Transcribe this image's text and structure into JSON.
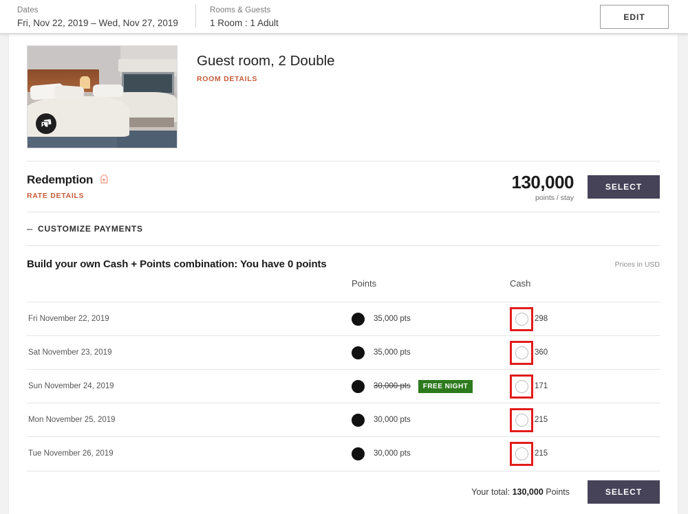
{
  "topbar": {
    "dates_label": "Dates",
    "dates_value": "Fri, Nov 22, 2019 – Wed, Nov 27, 2019",
    "guests_label": "Rooms & Guests",
    "guests_value": "1 Room : 1 Adult",
    "edit_button": "EDIT"
  },
  "room": {
    "title": "Guest room, 2 Double",
    "details_link": "ROOM DETAILS",
    "photo_badge_icon": "photo-gallery-icon"
  },
  "rate": {
    "name": "Redemption",
    "tag_icon": "tag-icon",
    "details_link": "RATE DETAILS",
    "price_amount": "130,000",
    "price_unit": "points / stay",
    "select_button": "SELECT"
  },
  "customize": {
    "toggle_glyph": "–",
    "label": "CUSTOMIZE PAYMENTS"
  },
  "build": {
    "title": "Build your own Cash + Points combination: You have 0 points",
    "prices_note": "Prices in USD",
    "col_points": "Points",
    "col_cash": "Cash",
    "rows": [
      {
        "date": "Fri November 22, 2019",
        "points": "35,000 pts",
        "points_selected": true,
        "points_struck": false,
        "badge": null,
        "cash": "298",
        "cash_selected": false,
        "cash_highlight": true
      },
      {
        "date": "Sat November 23, 2019",
        "points": "35,000 pts",
        "points_selected": true,
        "points_struck": false,
        "badge": null,
        "cash": "360",
        "cash_selected": false,
        "cash_highlight": true
      },
      {
        "date": "Sun November 24, 2019",
        "points": "30,000 pts",
        "points_selected": true,
        "points_struck": true,
        "badge": "FREE NIGHT",
        "cash": "171",
        "cash_selected": false,
        "cash_highlight": true
      },
      {
        "date": "Mon November 25, 2019",
        "points": "30,000 pts",
        "points_selected": true,
        "points_struck": false,
        "badge": null,
        "cash": "215",
        "cash_selected": false,
        "cash_highlight": true
      },
      {
        "date": "Tue November 26, 2019",
        "points": "30,000 pts",
        "points_selected": true,
        "points_struck": false,
        "badge": null,
        "cash": "215",
        "cash_selected": false,
        "cash_highlight": true
      }
    ]
  },
  "footer": {
    "total_prefix": "Your total: ",
    "total_amount": "130,000",
    "total_suffix": " Points",
    "select_button": "SELECT"
  },
  "colors": {
    "accent_link": "#c75b39",
    "select_button": "#464257",
    "badge_green": "#2d7a1e",
    "highlight_red": "#e21b1b"
  }
}
